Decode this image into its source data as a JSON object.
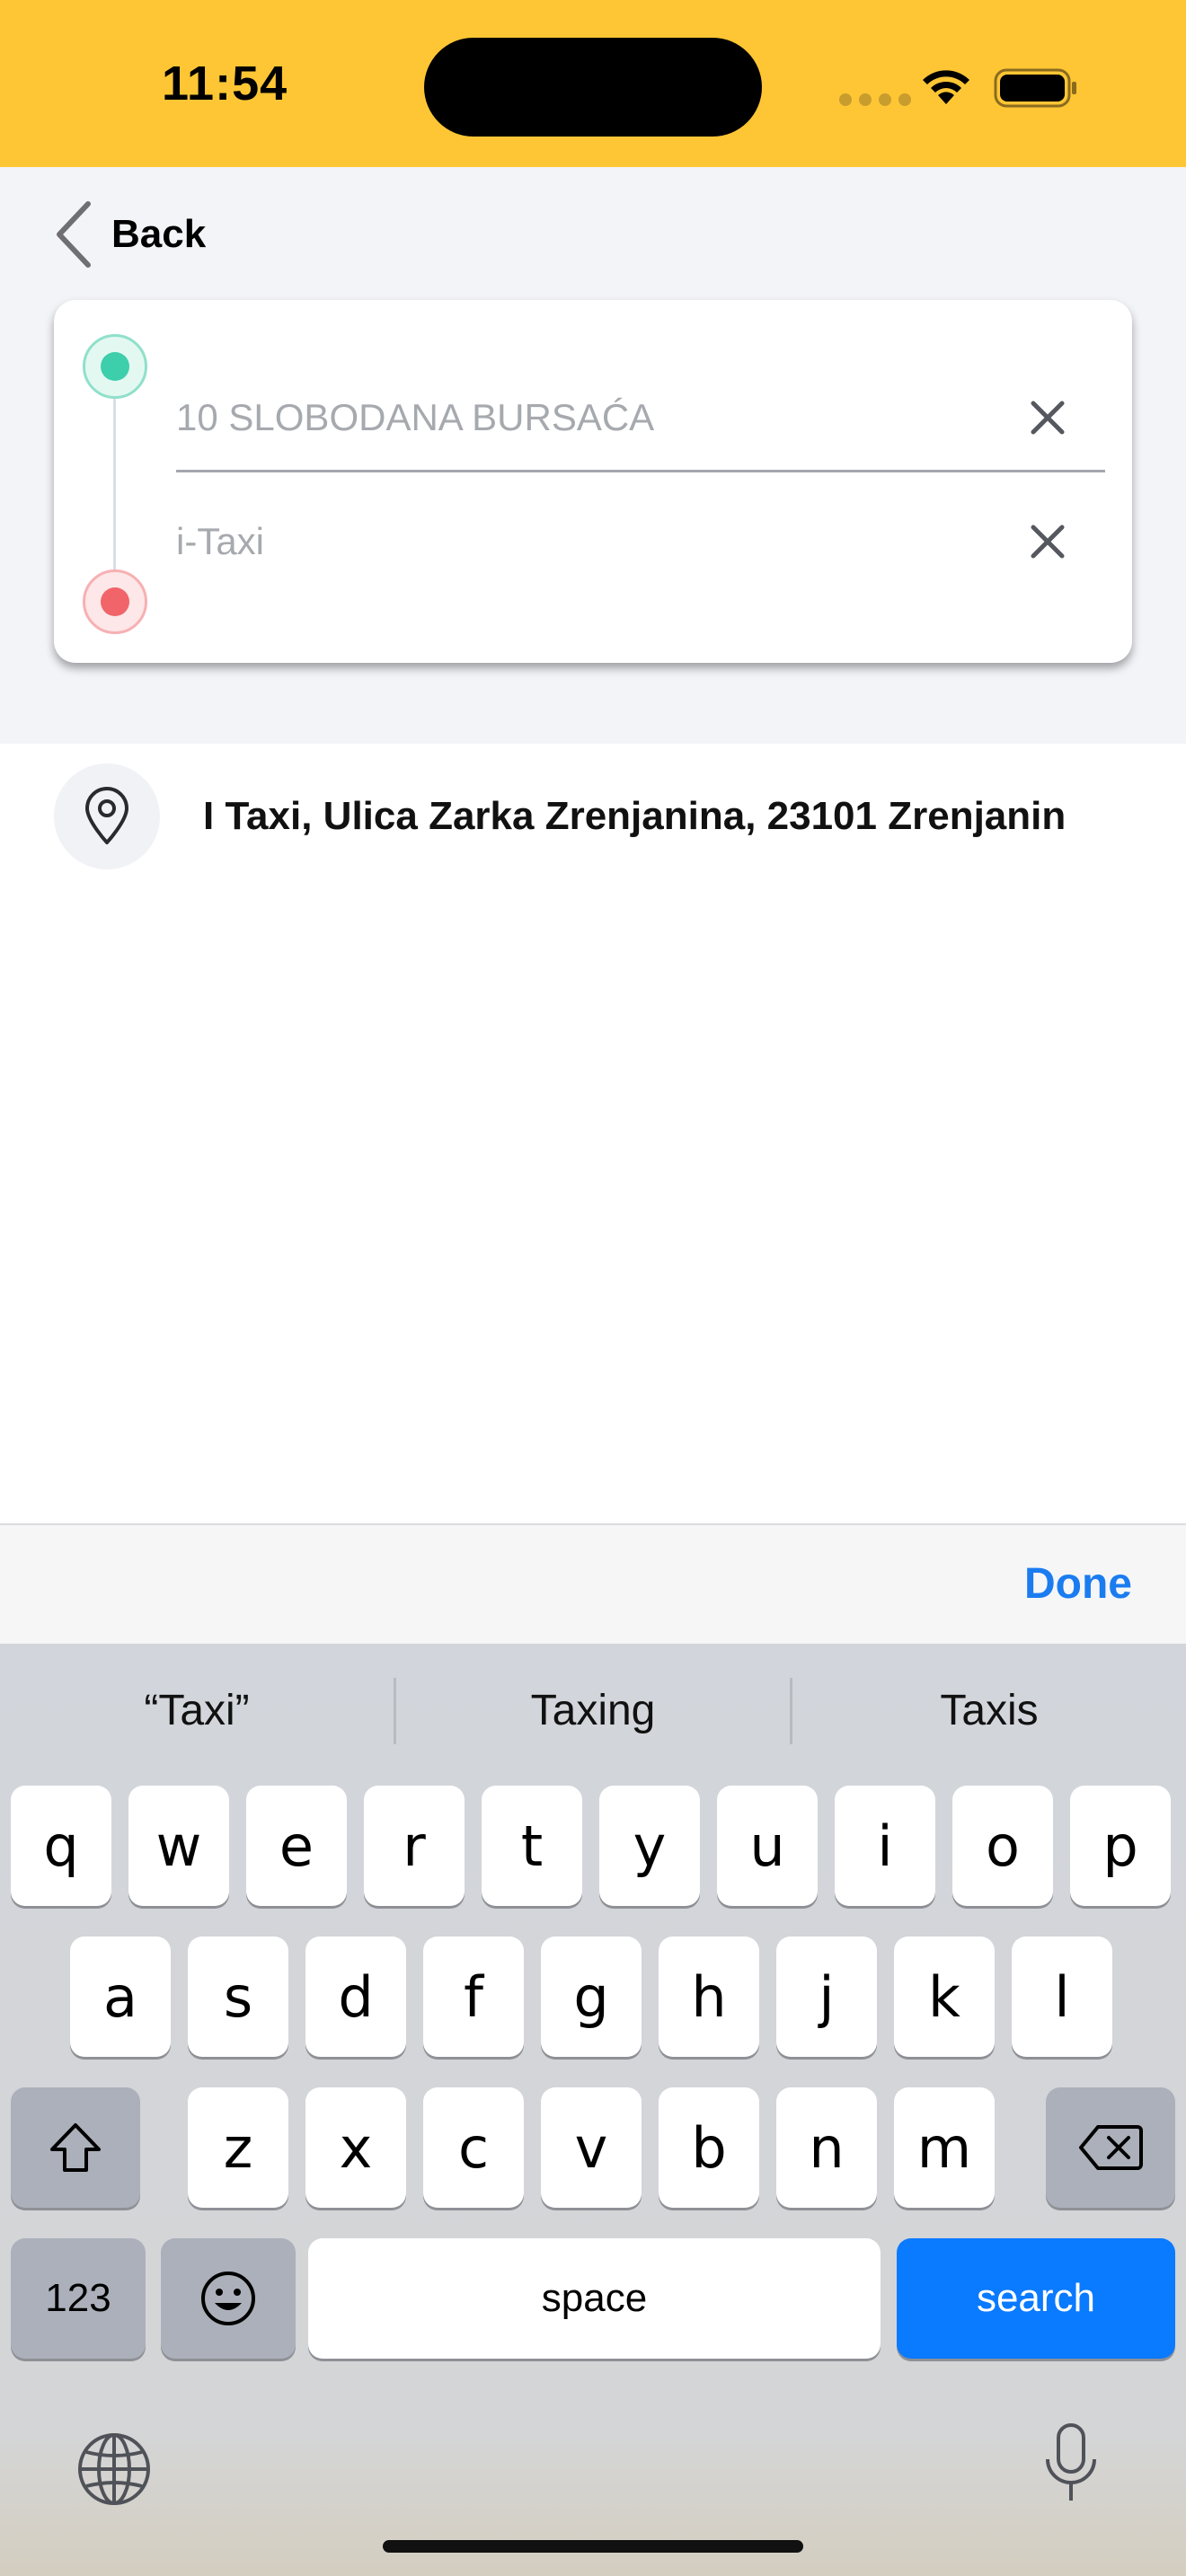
{
  "status_bar": {
    "time": "11:54",
    "background": "#FEC634"
  },
  "nav": {
    "back_label": "Back"
  },
  "route": {
    "pickup_value": "10 SLOBODANA BURSAĆA",
    "destination_value": "i-Taxi"
  },
  "results": [
    {
      "label": "I Taxi, Ulica Zarka Zrenjanina, 23101 Zrenjanin",
      "icon": "location-pin-icon"
    }
  ],
  "keyboard_accessory": {
    "done_label": "Done"
  },
  "keyboard": {
    "suggestions": [
      "“Taxi”",
      "Taxing",
      "Taxis"
    ],
    "row1": [
      "q",
      "w",
      "e",
      "r",
      "t",
      "y",
      "u",
      "i",
      "o",
      "p"
    ],
    "row2": [
      "a",
      "s",
      "d",
      "f",
      "g",
      "h",
      "j",
      "k",
      "l"
    ],
    "row3": [
      "z",
      "x",
      "c",
      "v",
      "b",
      "n",
      "m"
    ],
    "numbers_label": "123",
    "space_label": "space",
    "search_label": "search",
    "accent": "#0A7AFF"
  }
}
